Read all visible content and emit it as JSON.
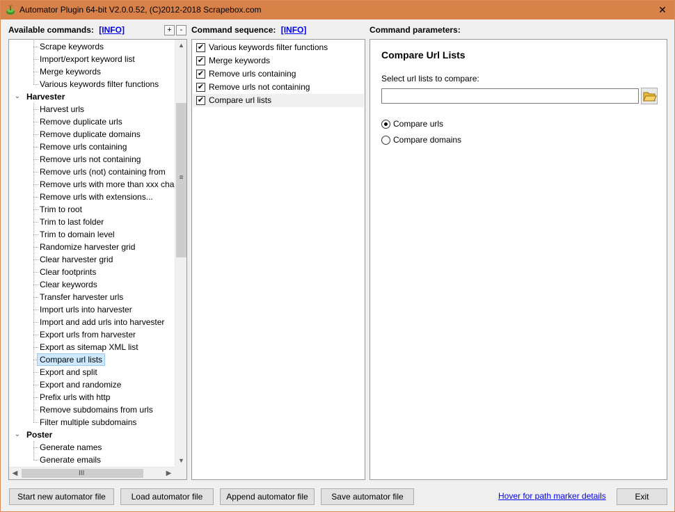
{
  "window": {
    "title": "Automator Plugin 64-bit V2.0.0.52, (C)2012-2018 Scrapebox.com",
    "close_glyph": "✕"
  },
  "available": {
    "label": "Available commands:",
    "info": "[INFO]",
    "expand_all": "+",
    "collapse_all": "-",
    "tree": [
      {
        "type": "child",
        "label": "Scrape keywords"
      },
      {
        "type": "child",
        "label": "Import/export keyword list"
      },
      {
        "type": "child",
        "label": "Merge keywords"
      },
      {
        "type": "child",
        "label": "Various keywords filter functions"
      },
      {
        "type": "group",
        "label": "Harvester"
      },
      {
        "type": "child",
        "label": "Harvest urls"
      },
      {
        "type": "child",
        "label": "Remove duplicate urls"
      },
      {
        "type": "child",
        "label": "Remove duplicate domains"
      },
      {
        "type": "child",
        "label": "Remove urls containing"
      },
      {
        "type": "child",
        "label": "Remove urls not containing"
      },
      {
        "type": "child",
        "label": "Remove urls (not) containing from"
      },
      {
        "type": "child",
        "label": "Remove urls with more than xxx cha"
      },
      {
        "type": "child",
        "label": "Remove urls with extensions..."
      },
      {
        "type": "child",
        "label": "Trim to root"
      },
      {
        "type": "child",
        "label": "Trim to last folder"
      },
      {
        "type": "child",
        "label": "Trim to domain level"
      },
      {
        "type": "child",
        "label": "Randomize harvester grid"
      },
      {
        "type": "child",
        "label": "Clear harvester grid"
      },
      {
        "type": "child",
        "label": "Clear footprints"
      },
      {
        "type": "child",
        "label": "Clear keywords"
      },
      {
        "type": "child",
        "label": "Transfer harvester urls"
      },
      {
        "type": "child",
        "label": "Import urls into harvester"
      },
      {
        "type": "child",
        "label": "Import and add urls into harvester"
      },
      {
        "type": "child",
        "label": "Export urls from harvester"
      },
      {
        "type": "child",
        "label": "Export as sitemap XML list"
      },
      {
        "type": "child",
        "label": "Compare url lists",
        "selected": true
      },
      {
        "type": "child",
        "label": "Export and split"
      },
      {
        "type": "child",
        "label": "Export and randomize"
      },
      {
        "type": "child",
        "label": "Prefix urls with http"
      },
      {
        "type": "child",
        "label": "Remove subdomains from urls"
      },
      {
        "type": "child",
        "label": "Filter multiple subdomains"
      },
      {
        "type": "group",
        "label": "Poster"
      },
      {
        "type": "child",
        "label": "Generate names"
      },
      {
        "type": "child",
        "label": "Generate emails"
      }
    ]
  },
  "sequence": {
    "label": "Command sequence:",
    "info": "[INFO]",
    "items": [
      {
        "label": "Various keywords filter functions",
        "checked": true
      },
      {
        "label": "Merge keywords",
        "checked": true
      },
      {
        "label": "Remove urls containing",
        "checked": true
      },
      {
        "label": "Remove urls not containing",
        "checked": true
      },
      {
        "label": "Compare url lists",
        "checked": true,
        "active": true
      }
    ]
  },
  "params": {
    "label": "Command parameters:",
    "title": "Compare Url Lists",
    "select_label": "Select url lists to compare:",
    "path_value": "",
    "options": [
      {
        "label": "Compare urls",
        "checked": true
      },
      {
        "label": "Compare domains",
        "checked": false
      }
    ]
  },
  "footer": {
    "start_new": "Start new automator file",
    "load": "Load automator file",
    "append": "Append automator file",
    "save": "Save automator file",
    "hover_link": "Hover for path marker details",
    "exit": "Exit"
  }
}
